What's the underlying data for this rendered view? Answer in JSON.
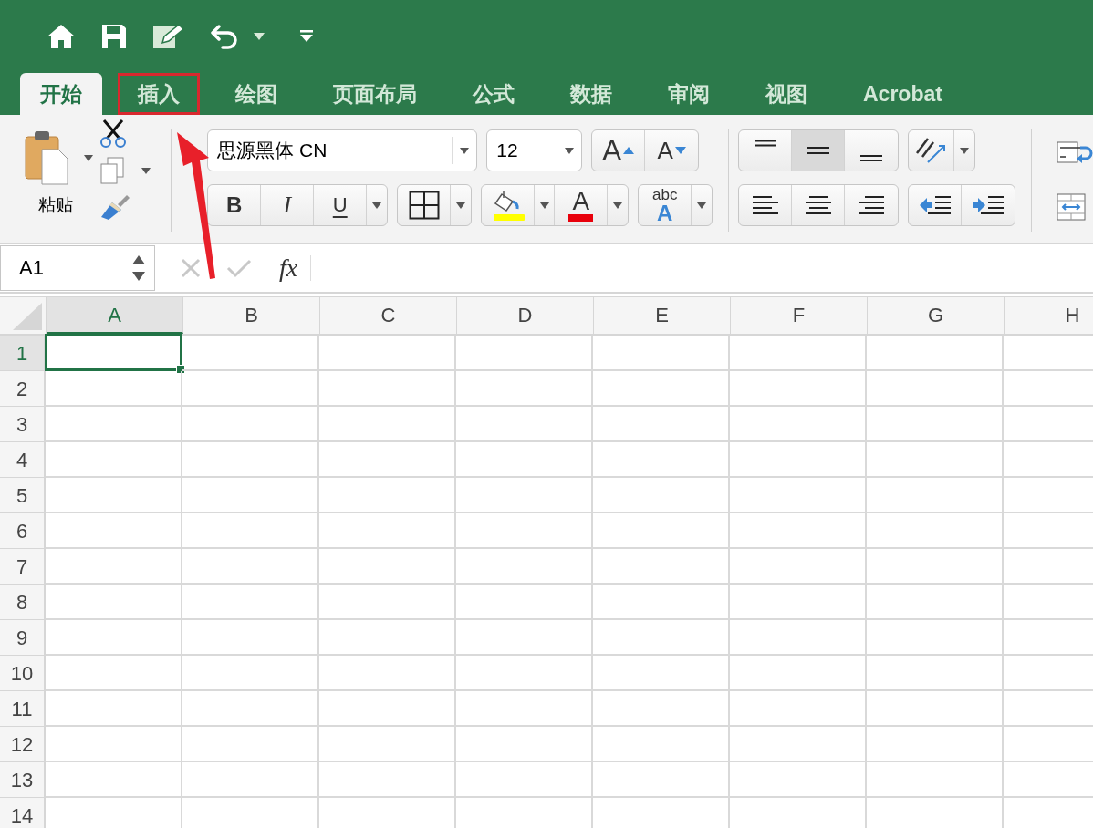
{
  "tabs": [
    {
      "label": "开始",
      "selected": true,
      "highlighted": false
    },
    {
      "label": "插入",
      "selected": false,
      "highlighted": true
    },
    {
      "label": "绘图",
      "selected": false,
      "highlighted": false
    },
    {
      "label": "页面布局",
      "selected": false,
      "highlighted": false
    },
    {
      "label": "公式",
      "selected": false,
      "highlighted": false
    },
    {
      "label": "数据",
      "selected": false,
      "highlighted": false
    },
    {
      "label": "审阅",
      "selected": false,
      "highlighted": false
    },
    {
      "label": "视图",
      "selected": false,
      "highlighted": false
    },
    {
      "label": "Acrobat",
      "selected": false,
      "highlighted": false
    }
  ],
  "ribbon": {
    "paste_label": "粘贴",
    "font_name": "思源黑体 CN",
    "font_size": "12",
    "grow_font": "A",
    "shrink_font": "A",
    "bold": "B",
    "italic": "I",
    "underline": "U",
    "font_color": "A",
    "text_style": [
      "abc",
      "A"
    ],
    "vertical_align": [
      {
        "selected": false
      },
      {
        "selected": true
      },
      {
        "selected": false
      }
    ]
  },
  "name_box": {
    "value": "A1"
  },
  "formula_bar": {
    "function_label": "fx"
  },
  "sheet": {
    "columns": [
      {
        "label": "A",
        "selected": true
      },
      {
        "label": "B",
        "selected": false
      },
      {
        "label": "C",
        "selected": false
      },
      {
        "label": "D",
        "selected": false
      },
      {
        "label": "E",
        "selected": false
      },
      {
        "label": "F",
        "selected": false
      },
      {
        "label": "G",
        "selected": false
      },
      {
        "label": "H",
        "selected": false
      }
    ],
    "rows": [
      {
        "label": "1",
        "selected": true
      },
      {
        "label": "2",
        "selected": false
      },
      {
        "label": "3",
        "selected": false
      },
      {
        "label": "4",
        "selected": false
      },
      {
        "label": "5",
        "selected": false
      },
      {
        "label": "6",
        "selected": false
      },
      {
        "label": "7",
        "selected": false
      },
      {
        "label": "8",
        "selected": false
      },
      {
        "label": "9",
        "selected": false
      },
      {
        "label": "10",
        "selected": false
      },
      {
        "label": "11",
        "selected": false
      },
      {
        "label": "12",
        "selected": false
      },
      {
        "label": "13",
        "selected": false
      },
      {
        "label": "14",
        "selected": false
      }
    ]
  }
}
